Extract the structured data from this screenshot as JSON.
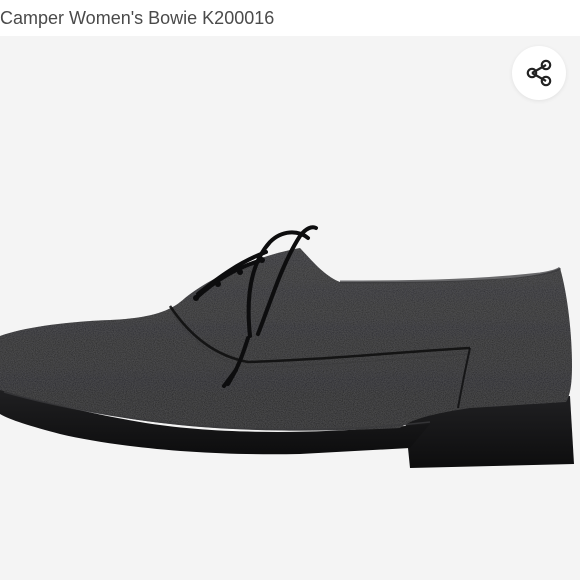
{
  "product": {
    "title": "Camper Women's Bowie K200016"
  },
  "actions": {
    "share_icon": "share-icon"
  },
  "image": {
    "subject": "black lace-up oxford shoe",
    "background": "#f4f4f4",
    "shoe_color": "#1b1b1c"
  }
}
